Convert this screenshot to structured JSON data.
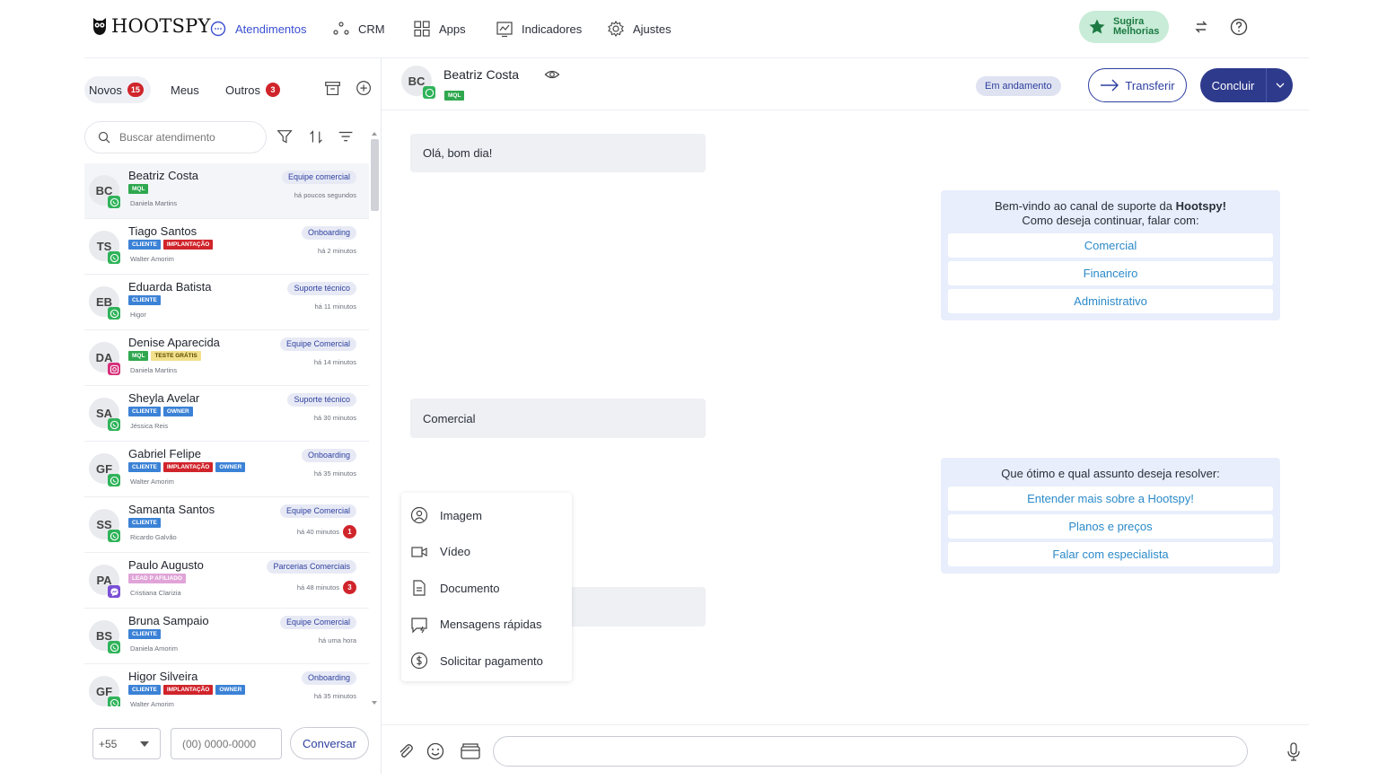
{
  "brand": {
    "logo_text": "HOOTSPY"
  },
  "nav": {
    "items": [
      {
        "label": "Atendimentos",
        "icon": "chat-bubble-icon",
        "active": true
      },
      {
        "label": "CRM",
        "icon": "crm-nodes-icon"
      },
      {
        "label": "Apps",
        "icon": "apps-grid-icon"
      },
      {
        "label": "Indicadores",
        "icon": "chart-board-icon"
      },
      {
        "label": "Ajustes",
        "icon": "gear-icon"
      }
    ],
    "suggest_label_1": "Sugira",
    "suggest_label_2": "Melhorias"
  },
  "sidebar": {
    "tabs": [
      {
        "label": "Novos",
        "badge": "15",
        "active": true
      },
      {
        "label": "Meus",
        "badge": ""
      },
      {
        "label": "Outros",
        "badge": "3"
      }
    ],
    "search_placeholder": "Buscar atendimento",
    "conversations": [
      {
        "initials": "BC",
        "name": "Beatriz Costa",
        "tags": [
          {
            "t": "MQL",
            "c": "#2fa84f"
          }
        ],
        "agent": "Daniela Martins",
        "team": "Equipe comercial",
        "time": "há poucos segundos",
        "unread": "",
        "channel": "whatsapp"
      },
      {
        "initials": "TS",
        "name": "Tiago Santos",
        "tags": [
          {
            "t": "CLIENTE",
            "c": "#3b82d6"
          },
          {
            "t": "IMPLANTAÇÃO",
            "c": "#d0242b"
          }
        ],
        "agent": "Walter Amorim",
        "team": "Onboarding",
        "time": "há 2 minutos",
        "unread": "",
        "channel": "whatsapp"
      },
      {
        "initials": "EB",
        "name": "Eduarda Batista",
        "tags": [
          {
            "t": "CLIENTE",
            "c": "#3b82d6"
          }
        ],
        "agent": "Higor",
        "team": "Suporte técnico",
        "time": "há 11 minutos",
        "unread": "",
        "channel": "whatsapp"
      },
      {
        "initials": "DA",
        "name": "Denise Aparecida",
        "tags": [
          {
            "t": "MQL",
            "c": "#2fa84f"
          },
          {
            "t": "TESTE GRÁTIS",
            "c": "#f3e08a",
            "dark": true
          }
        ],
        "agent": "Daniela Martins",
        "team": "Equipe Comercial",
        "time": "há 14 minutos",
        "unread": "",
        "channel": "instagram"
      },
      {
        "initials": "SA",
        "name": "Sheyla Avelar",
        "tags": [
          {
            "t": "CLIENTE",
            "c": "#3b82d6"
          },
          {
            "t": "OWNER",
            "c": "#3b82d6"
          }
        ],
        "agent": "Jéssica Reis",
        "team": "Suporte técnico",
        "time": "há 30 minutos",
        "unread": "",
        "channel": "whatsapp"
      },
      {
        "initials": "GF",
        "name": "Gabriel Felipe",
        "tags": [
          {
            "t": "CLIENTE",
            "c": "#3b82d6"
          },
          {
            "t": "IMPLANTAÇÃO",
            "c": "#d0242b"
          },
          {
            "t": "OWNER",
            "c": "#3b82d6"
          }
        ],
        "agent": "Walter Amorim",
        "team": "Onboarding",
        "time": "há 35 minutos",
        "unread": "",
        "channel": "whatsapp"
      },
      {
        "initials": "SS",
        "name": "Samanta Santos",
        "tags": [
          {
            "t": "CLIENTE",
            "c": "#3b82d6"
          }
        ],
        "agent": "Ricardo Galvão",
        "team": "Equipe Comercial",
        "time": "há 40 minutos",
        "unread": "1",
        "channel": "whatsapp"
      },
      {
        "initials": "PA",
        "name": "Paulo Augusto",
        "tags": [
          {
            "t": "LEAD P AFILIADO",
            "c": "#e0a4d8"
          }
        ],
        "agent": "Cristiana Clarizia",
        "team": "Parcerias Comerciais",
        "time": "há 48 minutos",
        "unread": "3",
        "channel": "messenger"
      },
      {
        "initials": "BS",
        "name": "Bruna Sampaio",
        "tags": [
          {
            "t": "CLIENTE",
            "c": "#3b82d6"
          }
        ],
        "agent": "Daniela Amorim",
        "team": "Equipe Comercial",
        "time": "há uma hora",
        "unread": "",
        "channel": "whatsapp"
      },
      {
        "initials": "GF",
        "name": "Higor Silveira",
        "tags": [
          {
            "t": "CLIENTE",
            "c": "#3b82d6"
          },
          {
            "t": "IMPLANTAÇÃO",
            "c": "#d0242b"
          },
          {
            "t": "OWNER",
            "c": "#3b82d6"
          }
        ],
        "agent": "Walter Amorim",
        "team": "Onboarding",
        "time": "há 35 minutos",
        "unread": "",
        "channel": "whatsapp"
      }
    ],
    "footer": {
      "ddi": "+55",
      "phone_placeholder": "(00) 0000-0000",
      "start_label": "Conversar"
    }
  },
  "chat": {
    "contact_initials": "BC",
    "contact_name": "Beatriz Costa",
    "contact_tag": "MQL",
    "status": "Em andamento",
    "transfer_label": "Transferir",
    "conclude_label": "Concluir",
    "messages": {
      "m1": "Olá, bom dia!",
      "bot1_line1": "Bem-vindo ao canal de suporte da ",
      "bot1_brand": "Hootspy!",
      "bot1_line2": "Como deseja continuar, falar com:",
      "bot1_options": [
        "Comercial",
        "Financeiro",
        "Administrativo"
      ],
      "m2": "Comercial",
      "bot2_question": "Que ótimo e qual assunto deseja resolver:",
      "bot2_options": [
        "Entender mais sobre a Hootspy!",
        "Planos e preços",
        "Falar com especialista"
      ]
    },
    "attach_menu": [
      "Imagem",
      "Vídeo",
      "Documento",
      "Mensagens rápidas",
      "Solicitar pagamento"
    ]
  },
  "colors": {
    "accent": "#2e3a8c",
    "active_nav": "#3a4ed1",
    "whatsapp": "#2fb35a",
    "badge": "#d0242b",
    "option_text": "#2b8ac9"
  }
}
